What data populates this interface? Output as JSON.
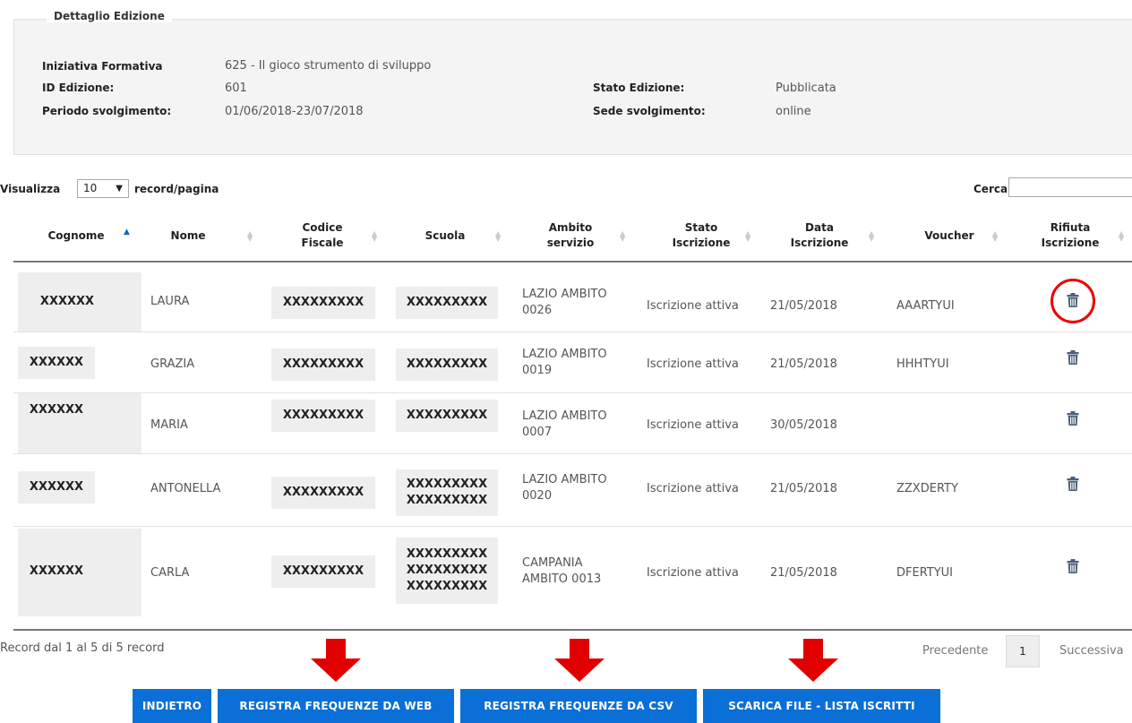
{
  "detail": {
    "legend": "Dettaglio Edizione",
    "labels": {
      "initiative": "Iniziativa Formativa",
      "edition_id": "ID Edizione:",
      "period": "Periodo svolgimento:",
      "status": "Stato Edizione:",
      "venue": "Sede svolgimento:"
    },
    "values": {
      "initiative": "625 - Il gioco strumento di sviluppo",
      "edition_id": "601",
      "period": "01/06/2018-23/07/2018",
      "status": "Pubblicata",
      "venue": "online"
    }
  },
  "toolbar": {
    "show_label": "Visualizza",
    "page_size": "10",
    "per_page_label": "record/pagina",
    "search_label": "Cerca:"
  },
  "table": {
    "headers": {
      "cognome": "Cognome",
      "nome": "Nome",
      "codice_1": "Codice",
      "codice_2": "Fiscale",
      "scuola": "Scuola",
      "ambito_1": "Ambito",
      "ambito_2": "servizio",
      "stato_1": "Stato",
      "stato_2": "Iscrizione",
      "data_1": "Data",
      "data_2": "Iscrizione",
      "voucher": "Voucher",
      "rifiuta_1": "Rifiuta",
      "rifiuta_2": "Iscrizione"
    },
    "rows": [
      {
        "cognome": "XXXXXX",
        "nome": "LAURA",
        "codice": "XXXXXXXXX",
        "scuola_1": "XXXXXXXXX",
        "scuola_2": "",
        "scuola_3": "",
        "ambito_1": "LAZIO AMBITO",
        "ambito_2": "0026",
        "stato": "Iscrizione attiva",
        "data": "21/05/2018",
        "voucher": "AAARTYUI"
      },
      {
        "cognome": "XXXXXX",
        "nome": "GRAZIA",
        "codice": "XXXXXXXXX",
        "scuola_1": "XXXXXXXXX",
        "scuola_2": "",
        "scuola_3": "",
        "ambito_1": "LAZIO AMBITO",
        "ambito_2": "0019",
        "stato": "Iscrizione attiva",
        "data": "21/05/2018",
        "voucher": "HHHTYUI"
      },
      {
        "cognome": "XXXXXX",
        "nome": "MARIA",
        "codice": "XXXXXXXXX",
        "scuola_1": "XXXXXXXXX",
        "scuola_2": "",
        "scuola_3": "",
        "ambito_1": "LAZIO AMBITO",
        "ambito_2": "0007",
        "stato": "Iscrizione attiva",
        "data": "30/05/2018",
        "voucher": ""
      },
      {
        "cognome": "XXXXXX",
        "nome": "ANTONELLA",
        "codice": "XXXXXXXXX",
        "scuola_1": "XXXXXXXXX",
        "scuola_2": "XXXXXXXXX",
        "scuola_3": "",
        "ambito_1": "LAZIO AMBITO",
        "ambito_2": "0020",
        "stato": "Iscrizione attiva",
        "data": "21/05/2018",
        "voucher": "ZZXDERTY"
      },
      {
        "cognome": "XXXXXX",
        "nome": "CARLA",
        "codice": "XXXXXXXXX",
        "scuola_1": "XXXXXXXXX",
        "scuola_2": "XXXXXXXXX",
        "scuola_3": "XXXXXXXXX",
        "ambito_1": "CAMPANIA",
        "ambito_2": "AMBITO 0013",
        "stato": "Iscrizione attiva",
        "data": "21/05/2018",
        "voucher": "DFERTYUI"
      }
    ]
  },
  "footer": {
    "record_info": "Record dal 1 al 5 di 5 record",
    "prev": "Precedente",
    "page": "1",
    "next": "Successiva"
  },
  "buttons": {
    "back": "INDIETRO",
    "web": "REGISTRA FREQUENZE DA WEB",
    "csv": "REGISTRA FREQUENZE DA CSV",
    "download": "SCARICA FILE - LISTA ISCRITTI"
  },
  "colors": {
    "primary_button": "#0a6fd6",
    "annotation_red": "#e00000",
    "sort_active": "#1565c0"
  },
  "icons": {
    "delete": "trash-icon",
    "sort_asc": "sort-asc-icon",
    "sort": "sort-icon",
    "annotation": "red-arrow-icon"
  }
}
